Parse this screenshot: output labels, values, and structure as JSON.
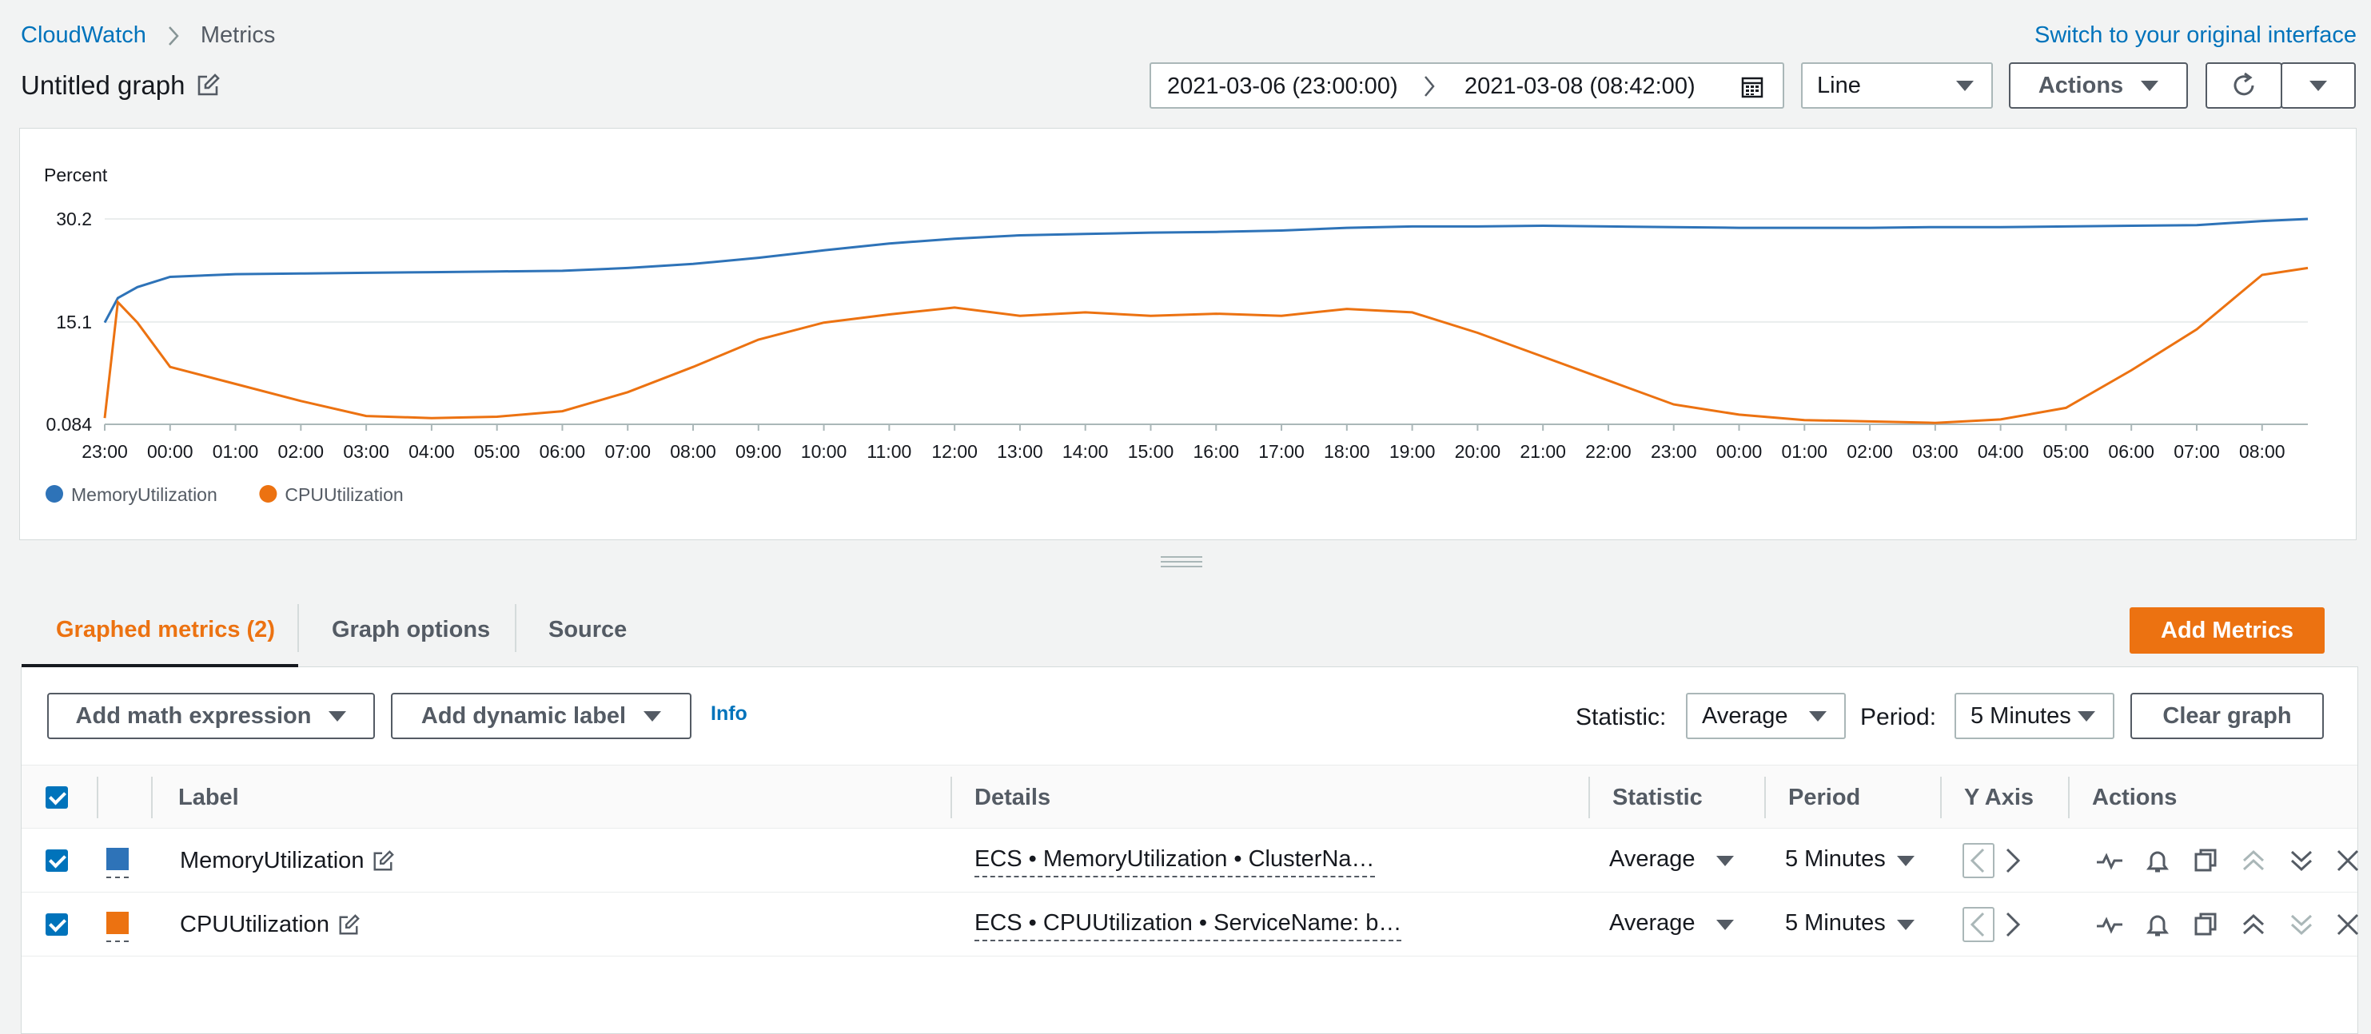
{
  "breadcrumb": {
    "root": "CloudWatch",
    "current": "Metrics"
  },
  "switch_link": "Switch to your original interface",
  "graph_title": "Untitled graph",
  "time_range": {
    "start": "2021-03-06 (23:00:00)",
    "end": "2021-03-08 (08:42:00)"
  },
  "view_type": "Line",
  "actions_label": "Actions",
  "chart_data": {
    "type": "line",
    "ylabel": "Percent",
    "yticks": [
      "30.2",
      "15.1",
      "0.084"
    ],
    "ylim": [
      0.084,
      30.2
    ],
    "xticks": [
      "23:00",
      "00:00",
      "01:00",
      "02:00",
      "03:00",
      "04:00",
      "05:00",
      "06:00",
      "07:00",
      "08:00",
      "09:00",
      "10:00",
      "11:00",
      "12:00",
      "13:00",
      "14:00",
      "15:00",
      "16:00",
      "17:00",
      "18:00",
      "19:00",
      "20:00",
      "21:00",
      "22:00",
      "23:00",
      "00:00",
      "01:00",
      "02:00",
      "03:00",
      "04:00",
      "05:00",
      "06:00",
      "07:00",
      "08:00"
    ],
    "x_hours": [
      0,
      0.2,
      0.5,
      1,
      2,
      3,
      4,
      5,
      6,
      7,
      8,
      9,
      10,
      11,
      12,
      13,
      14,
      15,
      16,
      17,
      18,
      19,
      20,
      21,
      22,
      23,
      24,
      25,
      26,
      27,
      28,
      29,
      30,
      31,
      32,
      33,
      33.7
    ],
    "series": [
      {
        "name": "MemoryUtilization",
        "color": "#2e73b8",
        "values": [
          15.0,
          18.6,
          20.2,
          21.7,
          22.1,
          22.2,
          22.3,
          22.4,
          22.5,
          22.6,
          23.0,
          23.6,
          24.5,
          25.6,
          26.6,
          27.3,
          27.8,
          28.0,
          28.2,
          28.3,
          28.5,
          28.9,
          29.1,
          29.1,
          29.2,
          29.1,
          29.0,
          28.9,
          28.9,
          28.9,
          29.0,
          29.0,
          29.1,
          29.2,
          29.3,
          29.9,
          30.2
        ]
      },
      {
        "name": "CPUUtilization",
        "color": "#ec7211",
        "values": [
          1.0,
          18.0,
          15.0,
          8.5,
          6.0,
          3.5,
          1.3,
          1.0,
          1.2,
          2.0,
          4.8,
          8.5,
          12.5,
          15.0,
          16.2,
          17.2,
          16.0,
          16.5,
          16.0,
          16.3,
          16.0,
          17.0,
          16.5,
          13.5,
          10.0,
          6.5,
          3.0,
          1.5,
          0.7,
          0.5,
          0.3,
          0.8,
          2.5,
          8.0,
          14.0,
          22.0,
          23.0
        ]
      }
    ],
    "legend_position": "bottom-left",
    "grid": true
  },
  "tabs": [
    {
      "label": "Graphed metrics (2)",
      "active": true
    },
    {
      "label": "Graph options",
      "active": false
    },
    {
      "label": "Source",
      "active": false
    }
  ],
  "add_metrics_label": "Add Metrics",
  "toolbar": {
    "math_expr": "Add math expression",
    "dyn_label": "Add dynamic label",
    "info": "Info",
    "statistic_label": "Statistic:",
    "statistic_value": "Average",
    "period_label": "Period:",
    "period_value": "5 Minutes",
    "clear": "Clear graph"
  },
  "table": {
    "headers": [
      "Label",
      "Details",
      "Statistic",
      "Period",
      "Y Axis",
      "Actions"
    ],
    "rows": [
      {
        "label": "MemoryUtilization",
        "color": "#2e73b8",
        "details": "ECS • MemoryUtilization • ClusterNa…",
        "statistic": "Average",
        "period": "5 Minutes"
      },
      {
        "label": "CPUUtilization",
        "color": "#ec7211",
        "details": "ECS • CPUUtilization • ServiceName: b…",
        "statistic": "Average",
        "period": "5 Minutes"
      }
    ]
  }
}
